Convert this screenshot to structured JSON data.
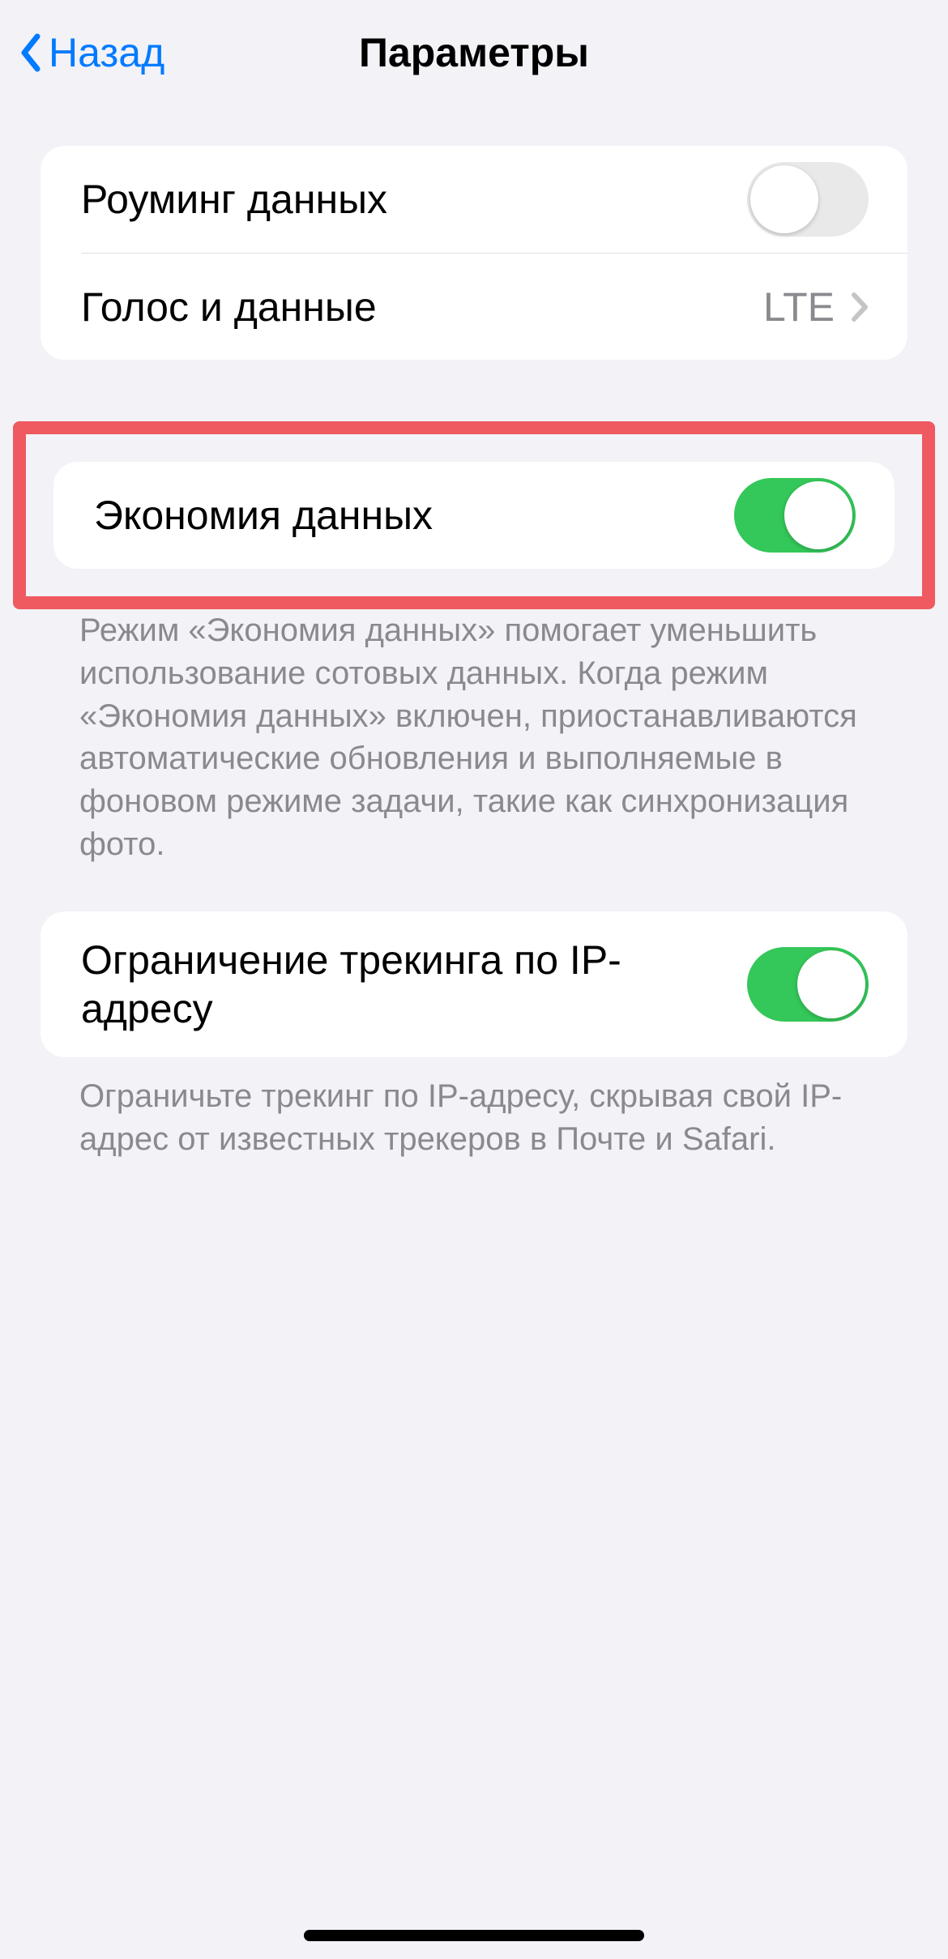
{
  "nav": {
    "back_label": "Назад",
    "title": "Параметры"
  },
  "groups": {
    "roaming": {
      "label": "Роуминг данных",
      "on": false
    },
    "voice_data": {
      "label": "Голос и данные",
      "value": "LTE"
    },
    "low_data": {
      "label": "Экономия данных",
      "on": true,
      "footer": "Режим «Экономия данных» помогает уменьшить использование сотовых данных. Когда режим «Экономия данных» включен, приостанавливаются автоматические обновления и выполняемые в фоновом режиме задачи, такие как синхронизация фото."
    },
    "limit_ip": {
      "label": "Ограничение трекинга по IP-адресу",
      "on": true,
      "footer": "Ограничьте трекинг по IP-адресу, скрывая свой IP-адрес от известных трекеров в Почте и Safari."
    }
  }
}
